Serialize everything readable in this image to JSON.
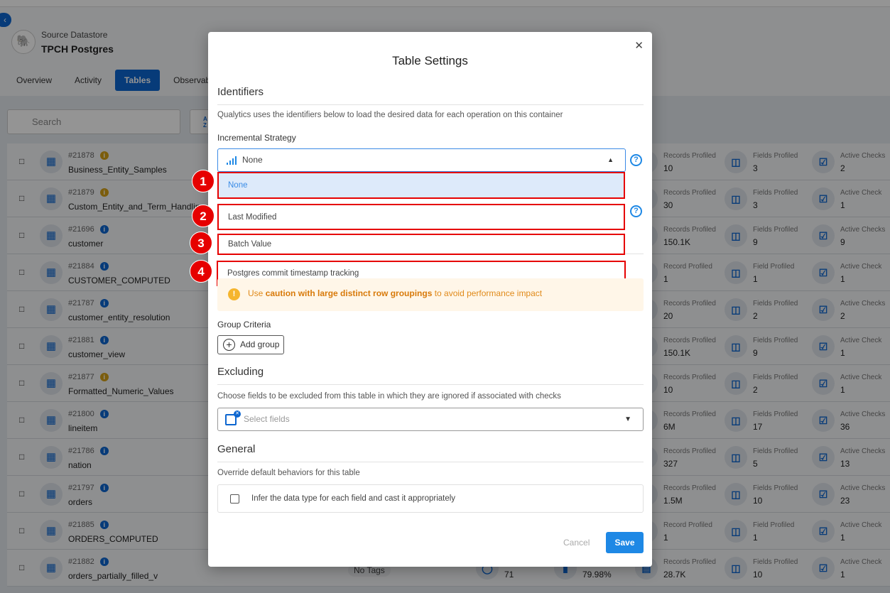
{
  "header": {
    "subtitle": "Source Datastore",
    "title": "TPCH Postgres",
    "back_icon": "chevron-left-icon"
  },
  "tabs": [
    {
      "label": "Overview"
    },
    {
      "label": "Activity"
    },
    {
      "label": "Tables",
      "active": true
    },
    {
      "label": "Observability"
    }
  ],
  "search": {
    "placeholder": "Search"
  },
  "sort_button": {
    "label_top": "A",
    "label_bottom": "Z"
  },
  "rows": [
    {
      "id": "#21878",
      "name": "Business_Entity_Samples",
      "info": "warning",
      "records_label": "Records Profiled",
      "records": "10",
      "fields_label": "Fields Profiled",
      "fields": "3",
      "checks_label": "Active Checks",
      "checks": "2",
      "computed": false
    },
    {
      "id": "#21879",
      "name": "Custom_Entity_and_Term_Handling",
      "info": "warning",
      "records_label": "Records Profiled",
      "records": "30",
      "fields_label": "Fields Profiled",
      "fields": "3",
      "checks_label": "Active Check",
      "checks": "1",
      "computed": false
    },
    {
      "id": "#21696",
      "name": "customer",
      "info": "info",
      "records_label": "Records Profiled",
      "records": "150.1K",
      "fields_label": "Fields Profiled",
      "fields": "9",
      "checks_label": "Active Checks",
      "checks": "9",
      "computed": false
    },
    {
      "id": "#21884",
      "name": "CUSTOMER_COMPUTED",
      "info": "info",
      "records_label": "Record Profiled",
      "records": "1",
      "fields_label": "Field Profiled",
      "fields": "1",
      "checks_label": "Active Check",
      "checks": "1",
      "computed": true
    },
    {
      "id": "#21787",
      "name": "customer_entity_resolution",
      "info": "info",
      "records_label": "Records Profiled",
      "records": "20",
      "fields_label": "Fields Profiled",
      "fields": "2",
      "checks_label": "Active Checks",
      "checks": "2",
      "computed": false
    },
    {
      "id": "#21881",
      "name": "customer_view",
      "info": "info",
      "records_label": "Records Profiled",
      "records": "150.1K",
      "fields_label": "Fields Profiled",
      "fields": "9",
      "checks_label": "Active Check",
      "checks": "1",
      "computed": false
    },
    {
      "id": "#21877",
      "name": "Formatted_Numeric_Values",
      "info": "warning",
      "records_label": "Records Profiled",
      "records": "10",
      "fields_label": "Fields Profiled",
      "fields": "2",
      "checks_label": "Active Check",
      "checks": "1",
      "computed": false
    },
    {
      "id": "#21800",
      "name": "lineitem",
      "info": "info",
      "records_label": "Records Profiled",
      "records": "6M",
      "fields_label": "Fields Profiled",
      "fields": "17",
      "checks_label": "Active Checks",
      "checks": "36",
      "computed": false
    },
    {
      "id": "#21786",
      "name": "nation",
      "info": "info",
      "records_label": "Records Profiled",
      "records": "327",
      "fields_label": "Fields Profiled",
      "fields": "5",
      "checks_label": "Active Checks",
      "checks": "13",
      "computed": false
    },
    {
      "id": "#21797",
      "name": "orders",
      "info": "info",
      "records_label": "Records Profiled",
      "records": "1.5M",
      "fields_label": "Fields Profiled",
      "fields": "10",
      "checks_label": "Active Checks",
      "checks": "23",
      "computed": false
    },
    {
      "id": "#21885",
      "name": "ORDERS_COMPUTED",
      "info": "info",
      "records_label": "Record Profiled",
      "records": "1",
      "fields_label": "Field Profiled",
      "fields": "1",
      "checks_label": "Active Check",
      "checks": "1",
      "computed": true
    },
    {
      "id": "#21882",
      "name": "orders_partially_filled_v",
      "info": "info",
      "records_label": "Records Profiled",
      "records": "28.7K",
      "fields_label": "Fields Profiled",
      "fields": "10",
      "checks_label": "Active Check",
      "checks": "1",
      "computed": false,
      "tags": "No Tags",
      "extra1": "71",
      "extra2": "79.98%"
    }
  ],
  "modal": {
    "title": "Table Settings",
    "identifiers": {
      "heading": "Identifiers",
      "description": "Qualytics uses the identifiers below to load the desired data for each operation on this container",
      "strategy_label": "Incremental Strategy",
      "strategy_value": "None",
      "options": [
        {
          "label": "None",
          "badge": "1",
          "selected": true
        },
        {
          "label": "Last Modified",
          "badge": "2"
        },
        {
          "label": "Batch Value",
          "badge": "3"
        },
        {
          "label": "Postgres commit timestamp tracking",
          "badge": "4"
        }
      ]
    },
    "warning": {
      "pre": "Use ",
      "bold": "caution with large distinct row groupings",
      "post": " to avoid performance impact"
    },
    "group_criteria": {
      "label": "Group Criteria",
      "button": "Add group"
    },
    "excluding": {
      "heading": "Excluding",
      "description": "Choose fields to be excluded from this table in which they are ignored if associated with checks",
      "placeholder": "Select fields"
    },
    "general": {
      "heading": "General",
      "description": "Override default behaviors for this table",
      "checkbox_label": "Infer the data type for each field and cast it appropriately",
      "checked": false
    },
    "cancel": "Cancel",
    "save": "Save"
  },
  "colors": {
    "accent": "#1e88e5",
    "primary": "#0d66d0",
    "annotation": "#e60000",
    "warning": "#f5b52e"
  }
}
